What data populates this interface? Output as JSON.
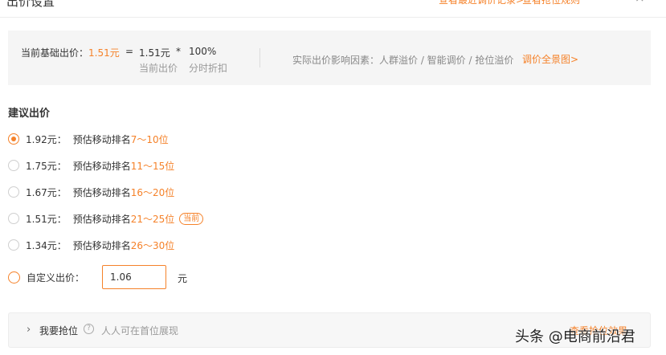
{
  "header": {
    "title": "出价设置",
    "link_history": "查看最近调价记录>",
    "link_grab": "查看抢位规则",
    "close": "×"
  },
  "summary": {
    "label_prefix": "当前基础出价：",
    "base_price": "1.51元",
    "equals": "=",
    "current_price": "1.51元",
    "multiply": "*",
    "discount": "100%",
    "current_price_label": "当前出价",
    "discount_label": "分时折扣",
    "factors": "实际出价影响因素：人群溢价 / 智能调价 / 抢位溢价",
    "panorama_link": "调价全景图>"
  },
  "suggest": {
    "title": "建议出价",
    "estimate_label": "预估移动排名",
    "options": [
      {
        "price": "1.92元：",
        "rank": "7～10位",
        "checked": true,
        "badge": ""
      },
      {
        "price": "1.75元：",
        "rank": "11～15位",
        "checked": false,
        "badge": ""
      },
      {
        "price": "1.67元：",
        "rank": "16～20位",
        "checked": false,
        "badge": ""
      },
      {
        "price": "1.51元：",
        "rank": "21～25位",
        "checked": false,
        "badge": "当前"
      },
      {
        "price": "1.34元：",
        "rank": "26～30位",
        "checked": false,
        "badge": ""
      }
    ]
  },
  "custom": {
    "label": "自定义出价：",
    "value": "1.06",
    "unit": "元"
  },
  "grab": {
    "title": "我要抢位",
    "help": "?",
    "desc": "人人可在首位展现",
    "more": "查看抢位效果"
  },
  "watermark": "头条 @电商前沿君",
  "colors": {
    "accent": "#f5822a",
    "panel_bg": "#f5f5f5"
  }
}
